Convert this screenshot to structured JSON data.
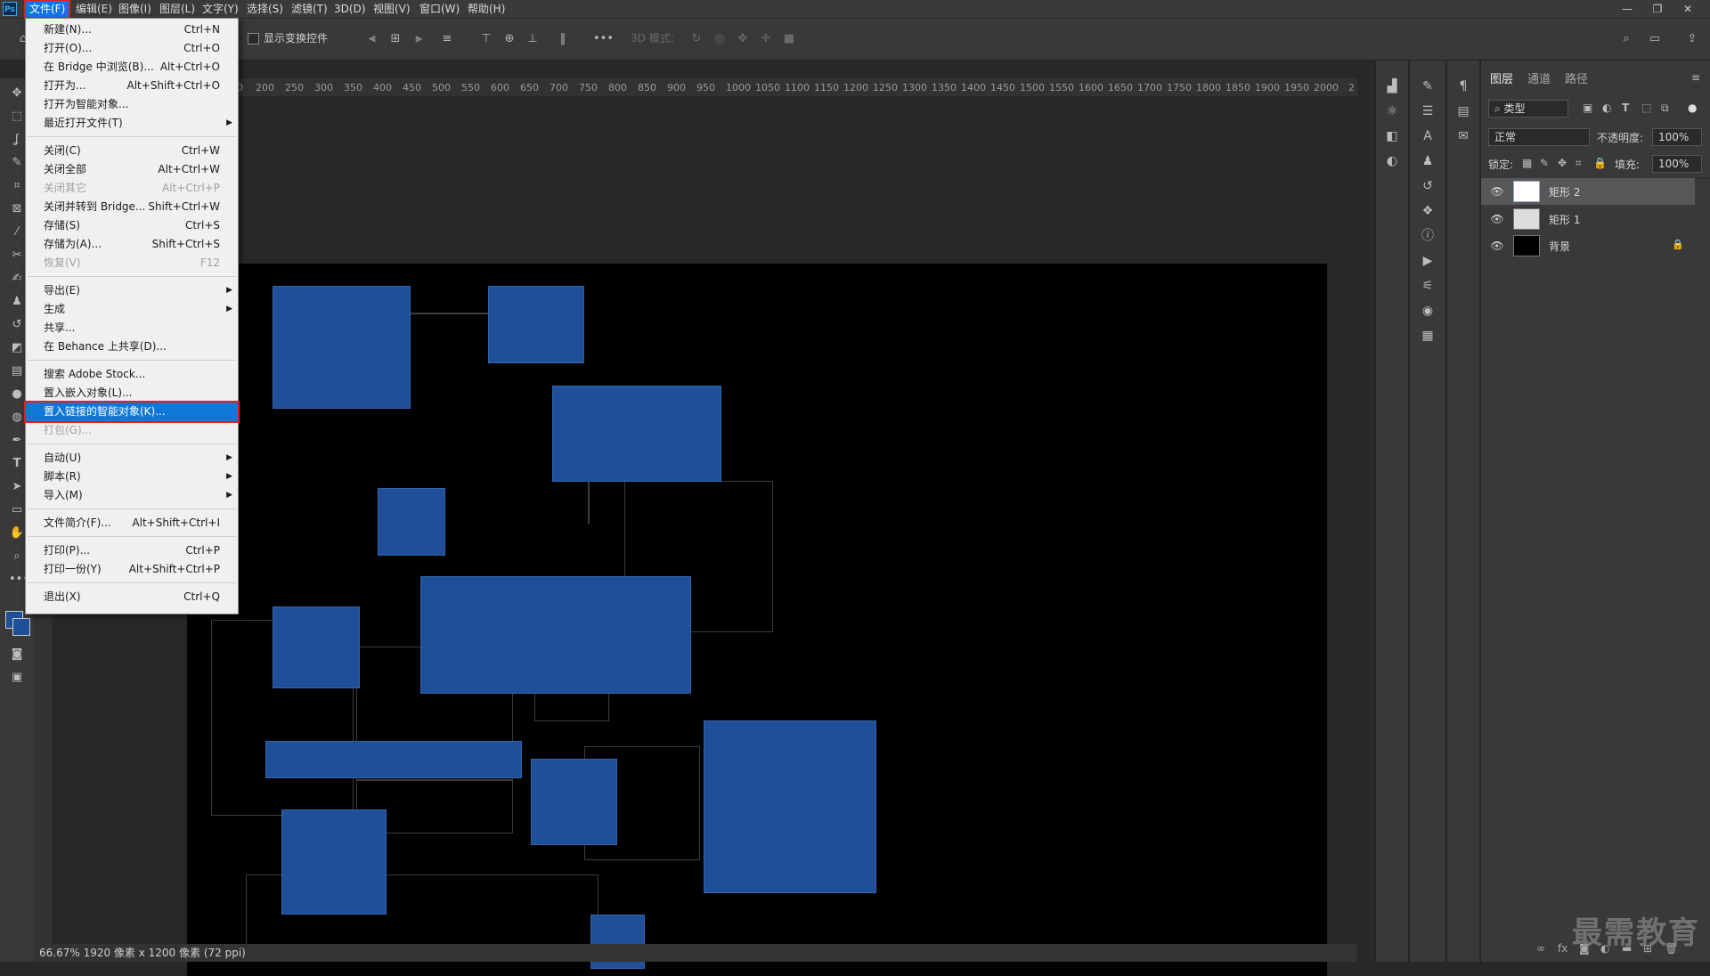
{
  "menubar": {
    "logo": "Ps",
    "items": [
      "文件(F)",
      "编辑(E)",
      "图像(I)",
      "图层(L)",
      "文字(Y)",
      "选择(S)",
      "滤镜(T)",
      "3D(D)",
      "视图(V)",
      "窗口(W)",
      "帮助(H)"
    ],
    "window_controls": [
      "—",
      "❐",
      "✕"
    ]
  },
  "options": {
    "show_transform": "显示变换控件",
    "mode_3d": "3D 模式:"
  },
  "ruler": {
    "ticks": [
      "0",
      "200",
      "250",
      "300",
      "350",
      "400",
      "450",
      "500",
      "550",
      "600",
      "650",
      "700",
      "750",
      "800",
      "850",
      "900",
      "950",
      "1000",
      "1050",
      "1100",
      "1150",
      "1200",
      "1250",
      "1300",
      "1350",
      "1400",
      "1450",
      "1500",
      "1550",
      "1600",
      "1650",
      "1700",
      "1750",
      "1800",
      "1850",
      "1900",
      "1950",
      "2000",
      "2"
    ]
  },
  "status": {
    "text": "66.67%  1920 像素 x 1200 像素 (72 ppi)"
  },
  "file_menu": {
    "items": [
      {
        "label": "新建(N)...",
        "shortcut": "Ctrl+N"
      },
      {
        "label": "打开(O)...",
        "shortcut": "Ctrl+O"
      },
      {
        "label": "在 Bridge 中浏览(B)...",
        "shortcut": "Alt+Ctrl+O"
      },
      {
        "label": "打开为...",
        "shortcut": "Alt+Shift+Ctrl+O"
      },
      {
        "label": "打开为智能对象...",
        "shortcut": ""
      },
      {
        "label": "最近打开文件(T)",
        "shortcut": "",
        "submenu": true
      },
      {
        "sep": true
      },
      {
        "label": "关闭(C)",
        "shortcut": "Ctrl+W"
      },
      {
        "label": "关闭全部",
        "shortcut": "Alt+Ctrl+W"
      },
      {
        "label": "关闭其它",
        "shortcut": "Alt+Ctrl+P",
        "disabled": true
      },
      {
        "label": "关闭并转到 Bridge...",
        "shortcut": "Shift+Ctrl+W"
      },
      {
        "label": "存储(S)",
        "shortcut": "Ctrl+S"
      },
      {
        "label": "存储为(A)...",
        "shortcut": "Shift+Ctrl+S"
      },
      {
        "label": "恢复(V)",
        "shortcut": "F12",
        "disabled": true
      },
      {
        "sep": true
      },
      {
        "label": "导出(E)",
        "shortcut": "",
        "submenu": true
      },
      {
        "label": "生成",
        "shortcut": "",
        "submenu": true
      },
      {
        "label": "共享...",
        "shortcut": ""
      },
      {
        "label": "在 Behance 上共享(D)...",
        "shortcut": ""
      },
      {
        "sep": true
      },
      {
        "label": "搜索 Adobe Stock...",
        "shortcut": ""
      },
      {
        "label": "置入嵌入对象(L)...",
        "shortcut": ""
      },
      {
        "label": "置入链接的智能对象(K)...",
        "shortcut": "",
        "highlight": true
      },
      {
        "label": "打包(G)...",
        "shortcut": "",
        "disabled": true
      },
      {
        "sep": true
      },
      {
        "label": "自动(U)",
        "shortcut": "",
        "submenu": true
      },
      {
        "label": "脚本(R)",
        "shortcut": "",
        "submenu": true
      },
      {
        "label": "导入(M)",
        "shortcut": "",
        "submenu": true
      },
      {
        "sep": true
      },
      {
        "label": "文件简介(F)...",
        "shortcut": "Alt+Shift+Ctrl+I"
      },
      {
        "sep": true
      },
      {
        "label": "打印(P)...",
        "shortcut": "Ctrl+P"
      },
      {
        "label": "打印一份(Y)",
        "shortcut": "Alt+Shift+Ctrl+P"
      },
      {
        "sep": true
      },
      {
        "label": "退出(X)",
        "shortcut": "Ctrl+Q"
      }
    ]
  },
  "layers_panel": {
    "tabs": [
      "图层",
      "通道",
      "路径"
    ],
    "filter_kind": "类型",
    "blend_mode": "正常",
    "opacity_label": "不透明度:",
    "opacity_value": "100%",
    "lock_label": "锁定:",
    "fill_label": "填充:",
    "fill_value": "100%",
    "layers": [
      {
        "name": "矩形 2",
        "selected": true
      },
      {
        "name": "矩形 1",
        "selected": false
      },
      {
        "name": "背景",
        "selected": false,
        "locked": true
      }
    ]
  },
  "watermark": "最需教育",
  "colors": {
    "accent": "#1473e6",
    "shape_fill": "#1f4f99",
    "highlight_border": "#e02020"
  }
}
